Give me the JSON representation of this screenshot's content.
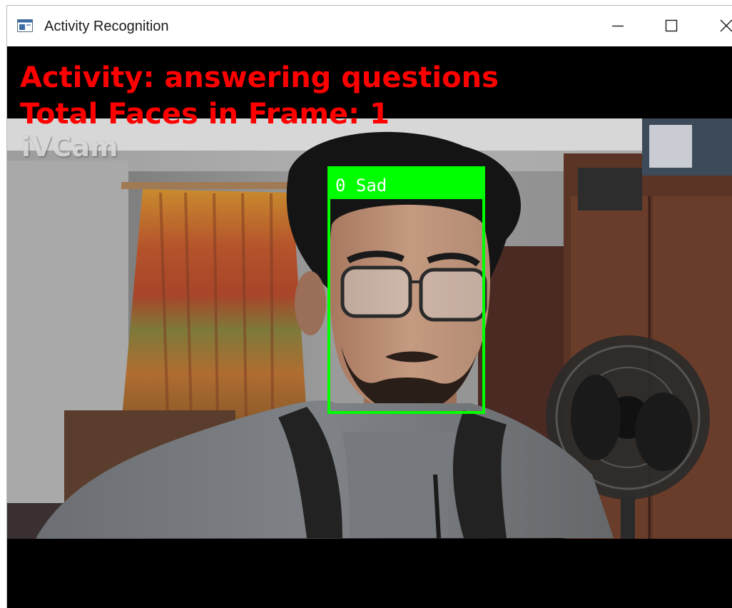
{
  "window": {
    "title": "Activity Recognition",
    "icon": "app-window-icon",
    "controls": {
      "minimize": "minimize-icon",
      "maximize": "maximize-icon",
      "close": "close-icon"
    }
  },
  "video": {
    "activity_text": "Activity: answering questions",
    "faces_text": "Total Faces in Frame: 1",
    "watermark": "iVCam",
    "detections": [
      {
        "label": "0 Sad",
        "box_color": "#00ff00"
      }
    ],
    "overlay_color": "#ff0000"
  }
}
